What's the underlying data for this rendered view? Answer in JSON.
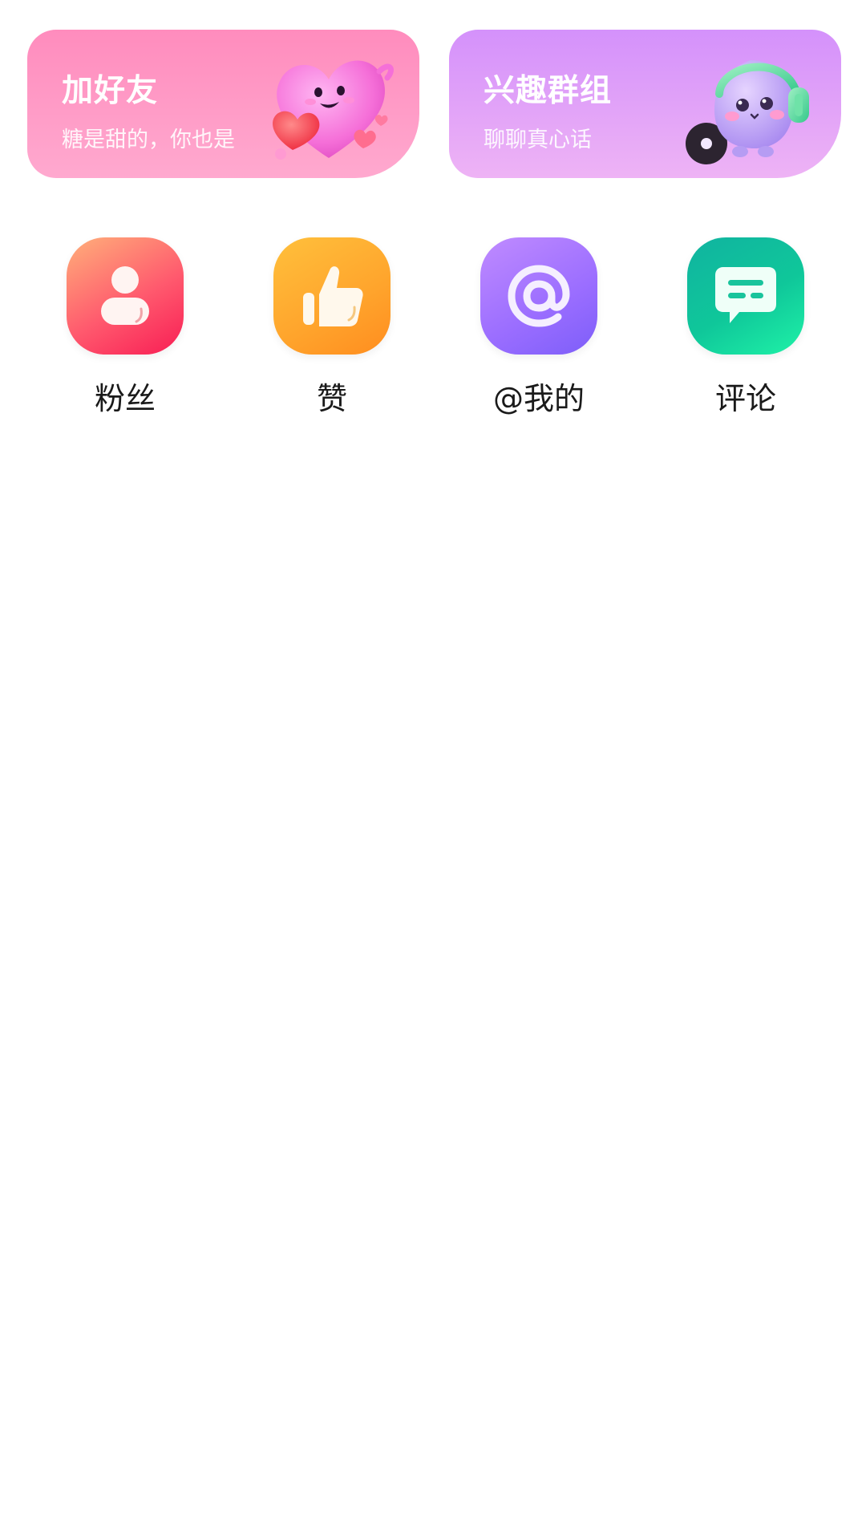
{
  "promo_cards": {
    "add_friends": {
      "title": "加好友",
      "subtitle": "糖是甜的，你也是",
      "art_icon": "heart-mascot-icon"
    },
    "interest_groups": {
      "title": "兴趣群组",
      "subtitle": "聊聊真心话",
      "art_icon": "headphone-mascot-icon"
    }
  },
  "quick_entries": [
    {
      "label": "粉丝",
      "icon": "person-icon",
      "color": "#f8315a"
    },
    {
      "label": "赞",
      "icon": "thumbs-up-icon",
      "color": "#ffa42c"
    },
    {
      "label": "@我的",
      "icon": "at-sign-icon",
      "color": "#8e66ff"
    },
    {
      "label": "评论",
      "icon": "comment-bubble-icon",
      "color": "#12c59b"
    }
  ]
}
